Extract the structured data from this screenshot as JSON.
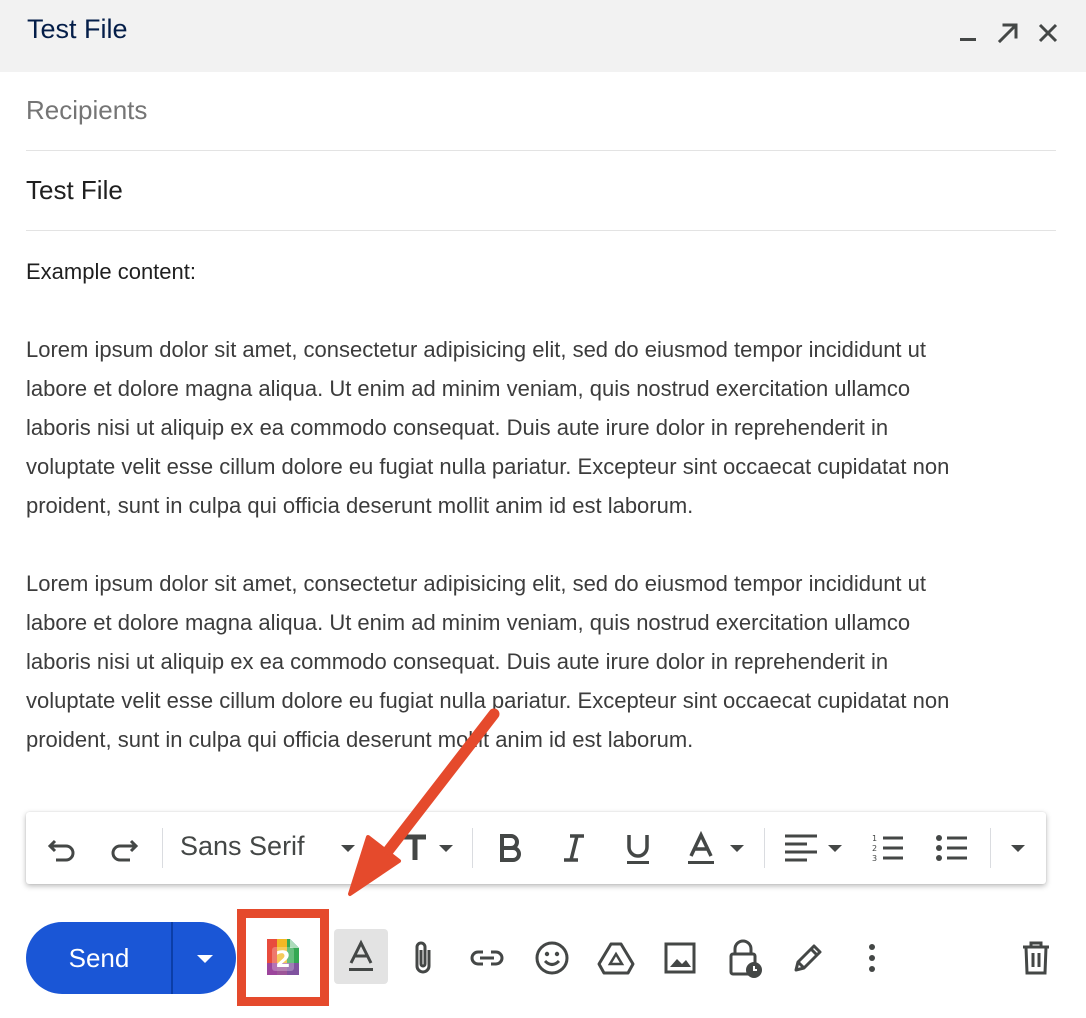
{
  "window": {
    "title": "Test File",
    "controls": [
      "minimize-icon",
      "pop-out-icon",
      "close-icon"
    ]
  },
  "fields": {
    "recipients_placeholder": "Recipients",
    "subject": "Test File"
  },
  "body": {
    "heading": "Example content:",
    "paragraphs": [
      [
        "Lorem ipsum dolor sit amet, consectetur adipisicing elit, sed do eiusmod tempor incididunt ut",
        "labore et dolore magna aliqua. Ut enim ad minim veniam, quis nostrud exercitation ullamco",
        "laboris nisi ut aliquip ex ea commodo consequat. Duis aute irure dolor in reprehenderit in",
        "voluptate velit esse cillum dolore eu fugiat nulla pariatur. Excepteur sint occaecat cupidatat non",
        "proident, sunt in culpa qui officia deserunt mollit anim id est laborum."
      ],
      [
        "Lorem ipsum dolor sit amet, consectetur adipisicing elit, sed do eiusmod tempor incididunt ut",
        "labore et dolore magna aliqua. Ut enim ad minim veniam, quis nostrud exercitation ullamco",
        "laboris nisi ut aliquip ex ea commodo consequat. Duis aute irure dolor in reprehenderit in",
        "voluptate velit esse cillum dolore eu fugiat nulla pariatur. Excepteur sint occaecat cupidatat non",
        "proident, sunt in culpa qui officia deserunt mollit anim id est laborum."
      ]
    ]
  },
  "formatting_toolbar": {
    "font": "Sans Serif",
    "icons": [
      "undo-icon",
      "redo-icon",
      "font-dropdown-icon",
      "text-size-icon",
      "bold-icon",
      "italic-icon",
      "underline-icon",
      "text-color-icon",
      "align-icon",
      "numbered-list-icon",
      "bulleted-list-icon",
      "more-formatting-icon"
    ]
  },
  "compose_actions": {
    "send_label": "Send",
    "extension_badge": "2",
    "icons": [
      "send-options-icon",
      "extension-icon",
      "formatting-options-icon",
      "attach-icon",
      "link-icon",
      "emoji-icon",
      "drive-icon",
      "photo-icon",
      "confidential-icon",
      "signature-icon",
      "more-options-icon",
      "discard-icon"
    ]
  },
  "annotation": {
    "highlight_color": "#e54a2c",
    "arrow_color": "#e54a2c"
  },
  "colors": {
    "send_button": "#1a56d6",
    "header_bg": "#f2f2f2",
    "title_text": "#041e49"
  }
}
